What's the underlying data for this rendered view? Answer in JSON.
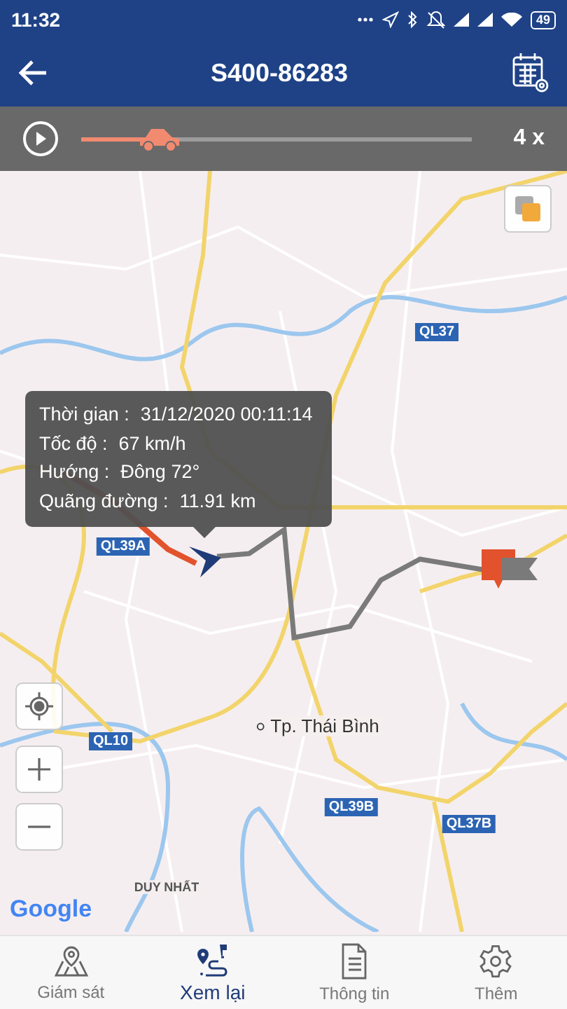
{
  "status_bar": {
    "time": "11:32",
    "battery": "49"
  },
  "header": {
    "title": "S400-86283"
  },
  "playback": {
    "level": 0.2,
    "speed": "4 x"
  },
  "map": {
    "labels": [
      {
        "text": "QL37",
        "kind": "road"
      },
      {
        "text": "QL39A",
        "kind": "road"
      },
      {
        "text": "QL10",
        "kind": "road"
      },
      {
        "text": "QL39B",
        "kind": "road"
      },
      {
        "text": "QL37B",
        "kind": "road"
      },
      {
        "text": "Tp. Thái Bình",
        "kind": "city"
      },
      {
        "text": "DUY NHẤT",
        "kind": "area"
      }
    ],
    "info": [
      {
        "label": "Thời gian :",
        "value": "31/12/2020 00:11:14"
      },
      {
        "label": "Tốc độ :",
        "value": "67 km/h"
      },
      {
        "label": "Hướng :",
        "value": "Đông 72°"
      },
      {
        "label": "Quãng đường :",
        "value": "11.91 km"
      }
    ],
    "attribution": "Google"
  },
  "nav": [
    {
      "label": "Giám sát",
      "selected": false
    },
    {
      "label": "Xem lại",
      "selected": true
    },
    {
      "label": "Thông tin",
      "selected": false
    },
    {
      "label": "Thêm",
      "selected": false
    }
  ]
}
